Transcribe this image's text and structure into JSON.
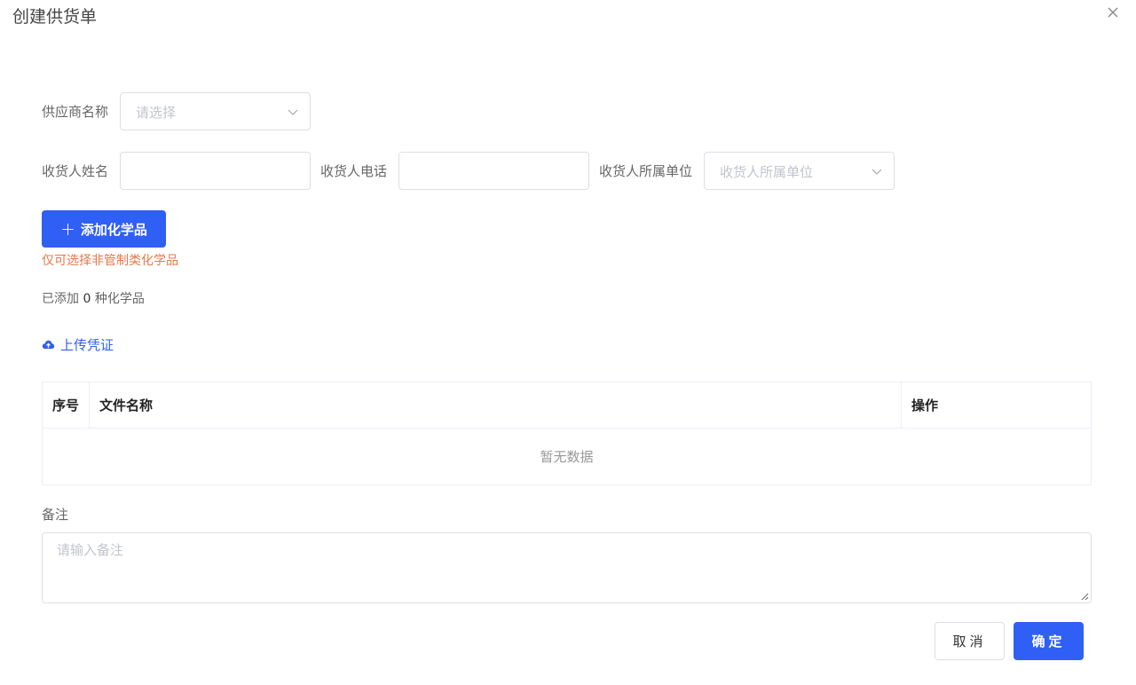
{
  "dialog": {
    "title": "创建供货单"
  },
  "form": {
    "supplier": {
      "label": "供应商名称",
      "placeholder": "请选择"
    },
    "receiver_name": {
      "label": "收货人姓名",
      "value": "",
      "placeholder": ""
    },
    "receiver_phone": {
      "label": "收货人电话",
      "value": "",
      "placeholder": ""
    },
    "receiver_unit": {
      "label": "收货人所属单位",
      "placeholder": "收货人所属单位"
    }
  },
  "chemicals": {
    "add_label": "添加化学品",
    "warning": "仅可选择非管制类化学品",
    "count_prefix": "已添加",
    "count": "0",
    "count_suffix": "种化学品"
  },
  "upload": {
    "label": "上传凭证"
  },
  "table": {
    "columns": [
      "序号",
      "文件名称",
      "操作"
    ],
    "empty_text": "暂无数据"
  },
  "remark": {
    "label": "备注",
    "placeholder": "请输入备注"
  },
  "footer": {
    "cancel": "取消",
    "confirm": "确定"
  },
  "colors": {
    "primary": "#2f5ff5",
    "warning": "#e6794b",
    "border": "#dcdfe6"
  },
  "icons": [
    "close-icon",
    "chevron-down-icon",
    "plus-icon",
    "cloud-upload-icon",
    "resize-handle-icon"
  ]
}
